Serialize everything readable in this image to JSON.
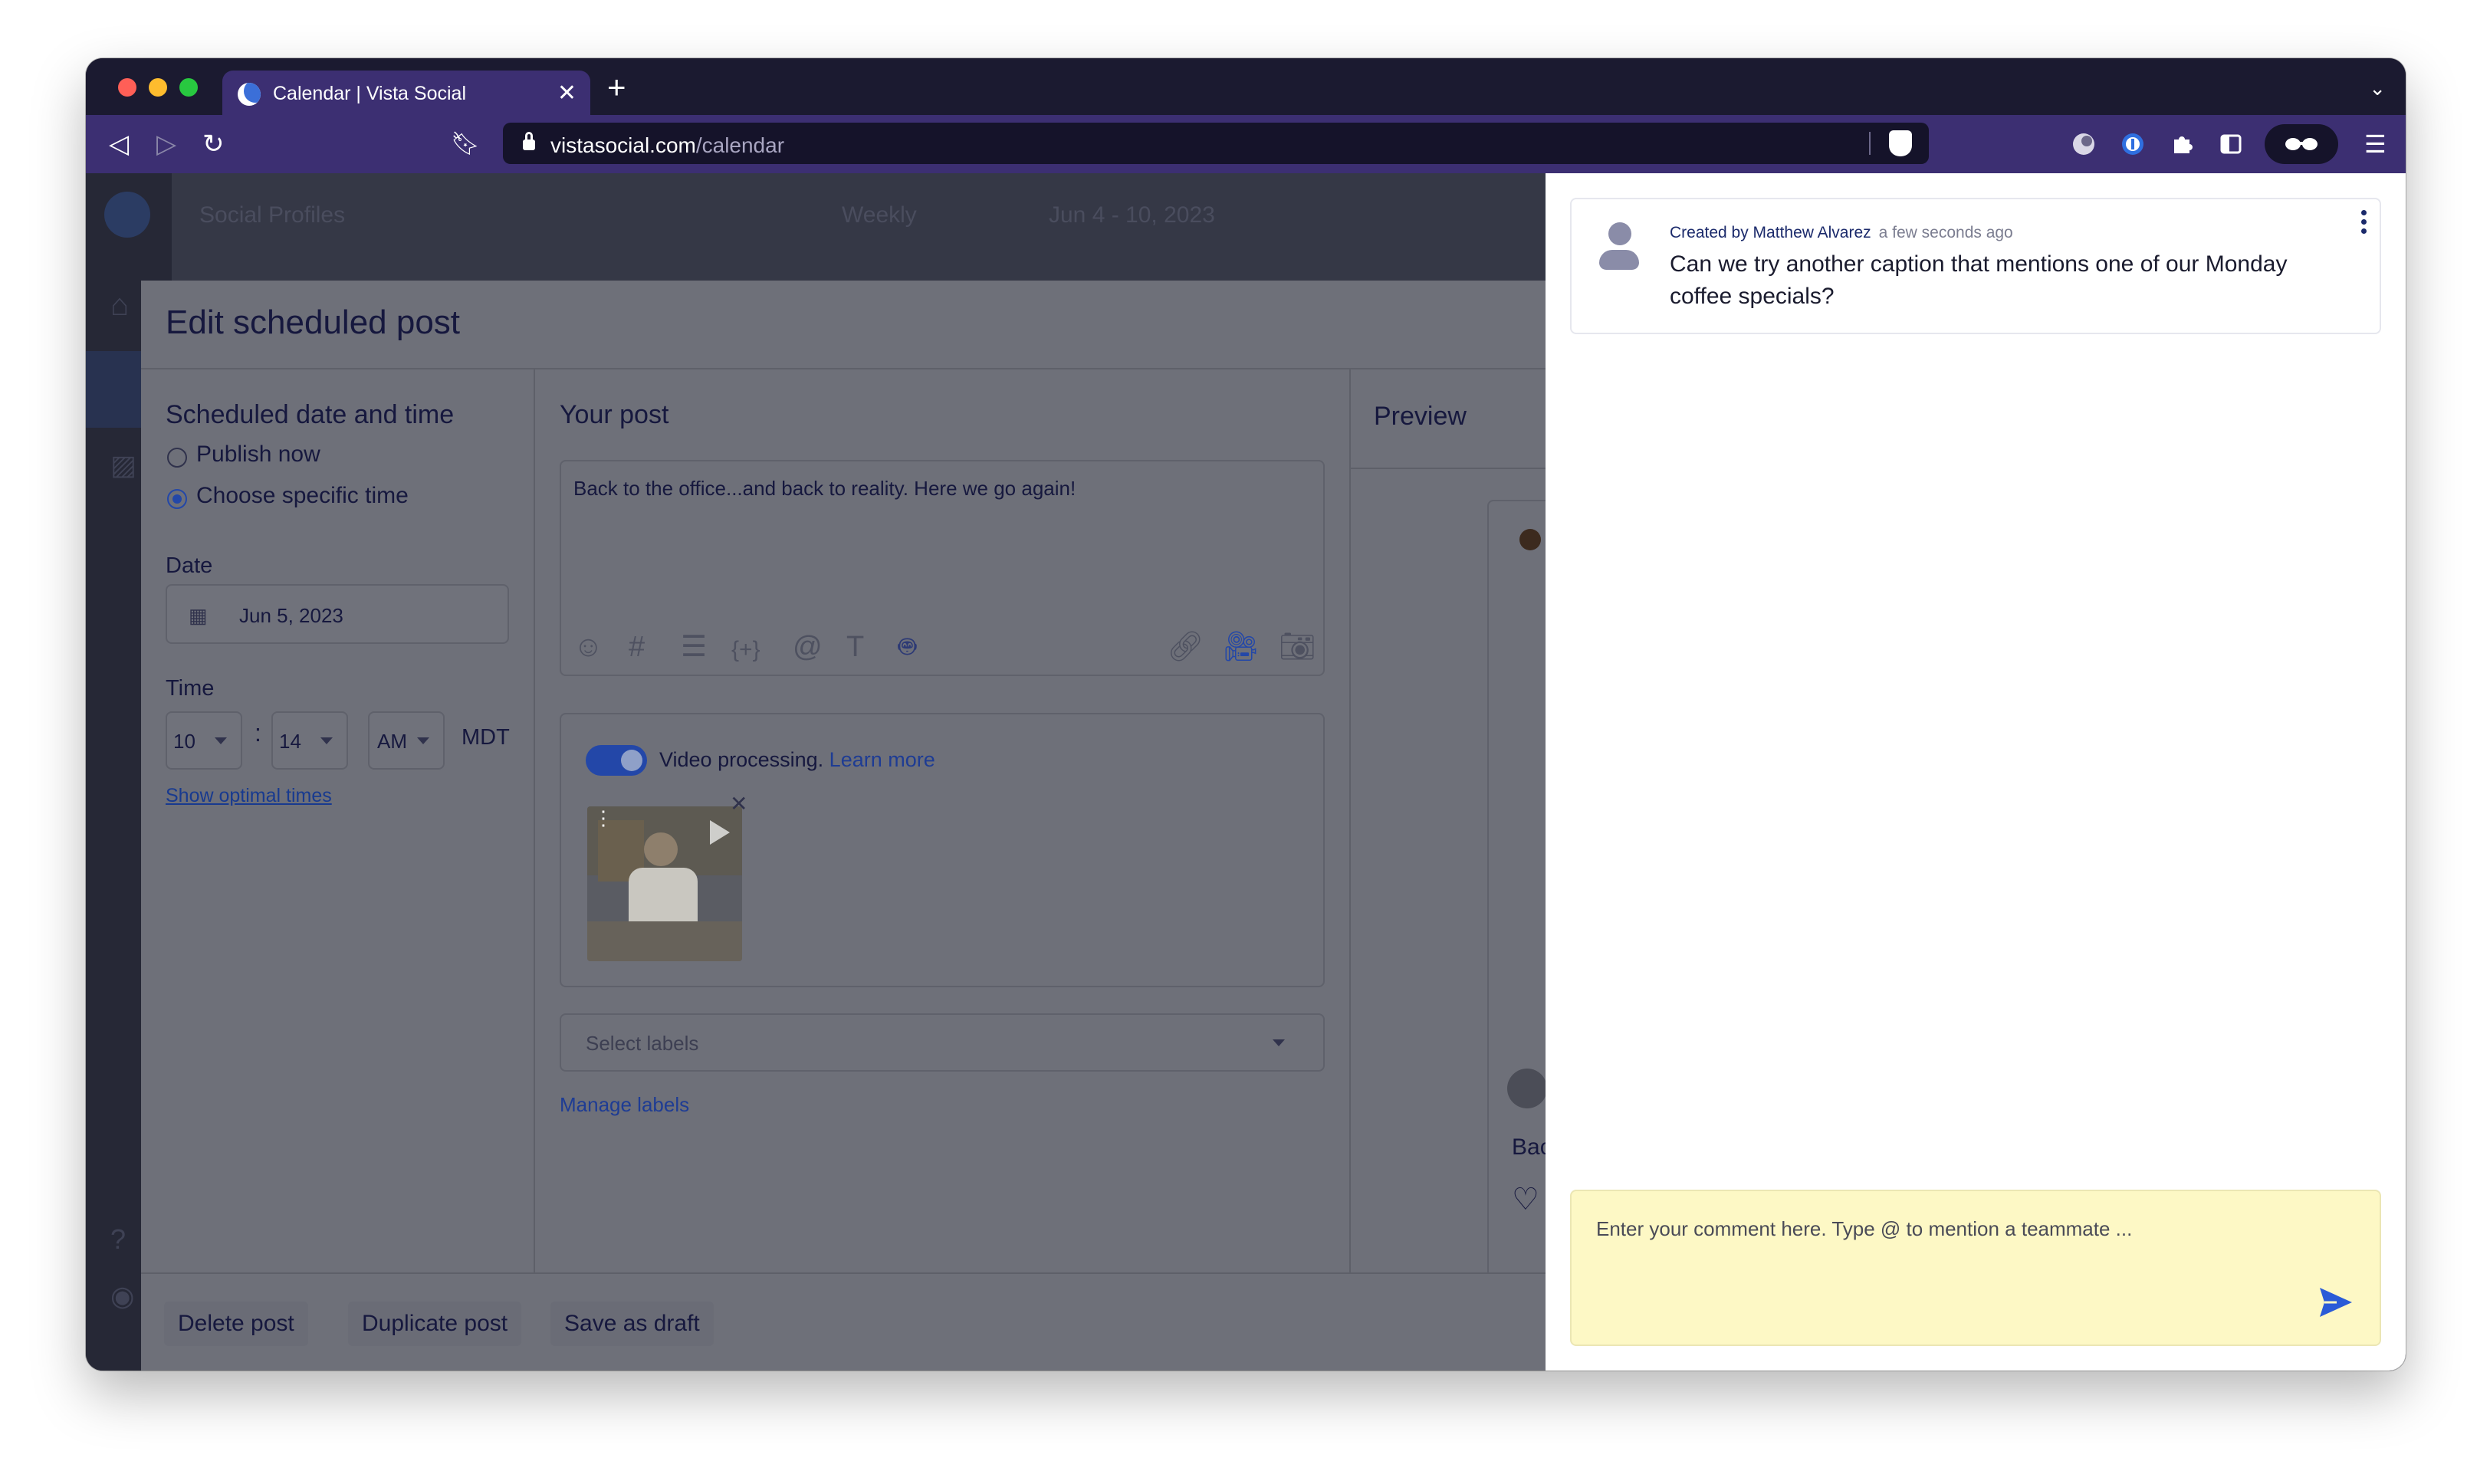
{
  "browser": {
    "tab_title": "Calendar | Vista Social",
    "url_domain": "vistasocial.com",
    "url_path": "/calendar"
  },
  "background": {
    "sidebar_text": "Social Profiles",
    "view": "Weekly",
    "date_range": "Jun 4 - 10, 2023"
  },
  "modal": {
    "title": "Edit scheduled post",
    "scheduled": {
      "heading": "Scheduled date and time",
      "options": [
        "Publish now",
        "Choose specific time"
      ],
      "selected": "Choose specific time",
      "date_label": "Date",
      "date_value": "Jun 5, 2023",
      "time_label": "Time",
      "hour": "10",
      "minute": "14",
      "ampm": "AM",
      "timezone": "MDT",
      "optimal_link": "Show optimal times"
    },
    "post": {
      "heading": "Your post",
      "text": "Back to the office...and back to reality. Here we go again!",
      "video_processing": "Video processing.",
      "learn_more": "Learn more",
      "labels_placeholder": "Select labels",
      "manage_labels": "Manage labels"
    },
    "preview": {
      "heading": "Preview",
      "caption_fragment": "Bac"
    },
    "footer": {
      "delete": "Delete post",
      "duplicate": "Duplicate post",
      "draft": "Save as draft"
    }
  },
  "comments": {
    "items": [
      {
        "author": "Created by Matthew Alvarez",
        "time": "a few seconds ago",
        "text": "Can we try another caption that mentions one of our Monday coffee specials?"
      }
    ],
    "placeholder": "Enter your comment here. Type @ to mention a teammate ..."
  },
  "colors": {
    "accent": "#2347a8",
    "composer_bg": "#fdf8c5",
    "browser_chrome": "#3c2f72"
  }
}
